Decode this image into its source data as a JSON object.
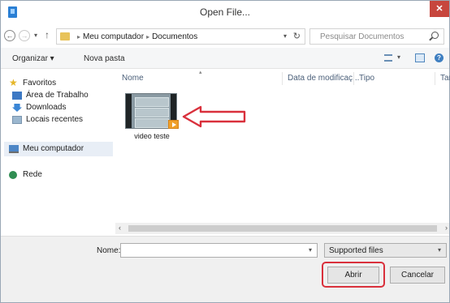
{
  "window": {
    "title": "Open File...",
    "close_glyph": "✕"
  },
  "address": {
    "back_glyph": "←",
    "forward_glyph": "→",
    "up_glyph": "↑",
    "breadcrumbs": [
      "Meu computador",
      "Documentos"
    ],
    "refresh_glyph": "↻",
    "search_placeholder": "Pesquisar Documentos"
  },
  "toolbar": {
    "organize_label": "Organizar ▾",
    "new_folder_label": "Nova pasta",
    "help_glyph": "?"
  },
  "navpane": {
    "items": [
      {
        "label": "Favoritos",
        "icon": "star-icon"
      },
      {
        "label": "Área de Trabalho",
        "icon": "desktop-icon"
      },
      {
        "label": "Downloads",
        "icon": "downloads-icon"
      },
      {
        "label": "Locais recentes",
        "icon": "recent-places-icon"
      },
      {
        "label": "Meu computador",
        "icon": "computer-icon"
      },
      {
        "label": "Rede",
        "icon": "network-icon"
      }
    ],
    "selected": "Meu computador"
  },
  "filelist": {
    "columns": [
      "Nome",
      "Data de modificaç...",
      "Tipo",
      "Tam"
    ],
    "files": [
      {
        "name": "video teste",
        "icon": "video-file-icon"
      }
    ],
    "annotation": "red-arrow-pointing-to-file"
  },
  "bottom": {
    "name_label": "Nome:",
    "name_value": "",
    "filter_value": "Supported files",
    "open_label": "Abrir",
    "cancel_label": "Cancelar"
  },
  "colors": {
    "accent": "#3f7fc1",
    "close": "#c7463d",
    "annotation_red": "#d9303c"
  }
}
